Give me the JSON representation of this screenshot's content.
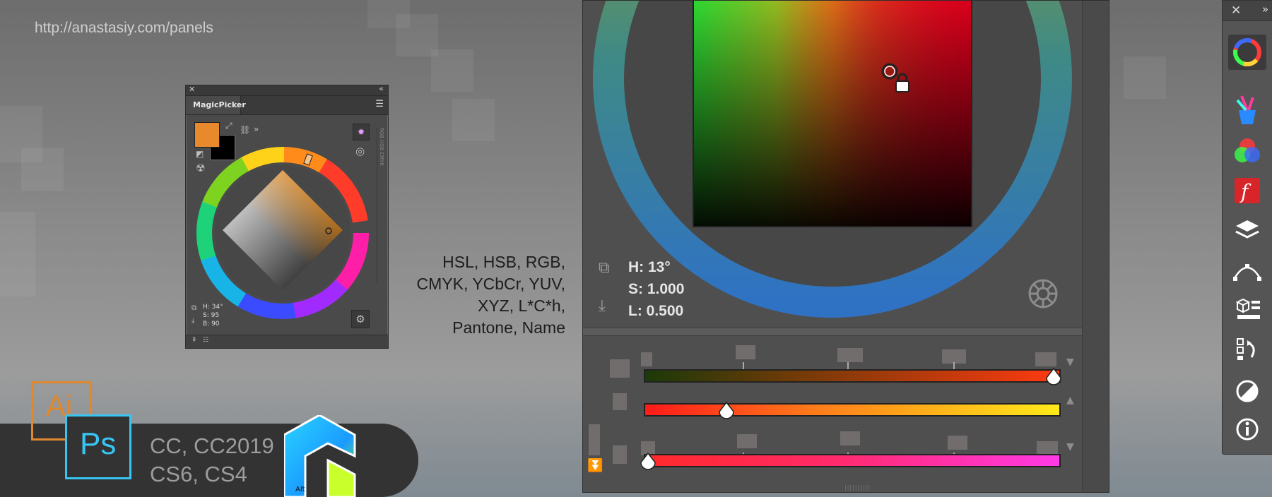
{
  "url": "http://anastasiy.com/panels",
  "mini_panel": {
    "tab_label": "MagicPicker",
    "readout": {
      "h": "H: 34°",
      "s": "S: 95",
      "b": "B: 90"
    },
    "vertical_label": "RGB HSB CMYK",
    "foreground_color": "#e8892e",
    "background_color": "#000000"
  },
  "color_models": [
    "HSL, HSB, RGB,",
    "CMYK, YCbCr, YUV,",
    "XYZ, L*C*h,",
    "Pantone, Name"
  ],
  "apps": {
    "ai": "Ai",
    "ps": "Ps"
  },
  "versions": [
    "CC, CC2019",
    "CS6, CS4"
  ],
  "logo_badge": "Alt",
  "big_panel": {
    "readout": {
      "h": "H: 13°",
      "s": "S: 1.000",
      "l": "L: 0.500"
    },
    "sliders": [
      {
        "name": "hue-to-red",
        "level": 1.0
      },
      {
        "name": "red-to-yellow",
        "level": 0.2
      },
      {
        "name": "red-to-magenta",
        "level": 0.0
      }
    ]
  },
  "toolbar": {
    "items": [
      "color-wheel-icon",
      "brush-cup-icon",
      "rgb-circles-icon",
      "script-icon",
      "layers-icon",
      "pen-path-icon",
      "3d-cube-icon",
      "history-icon",
      "contrast-icon",
      "info-icon"
    ]
  }
}
